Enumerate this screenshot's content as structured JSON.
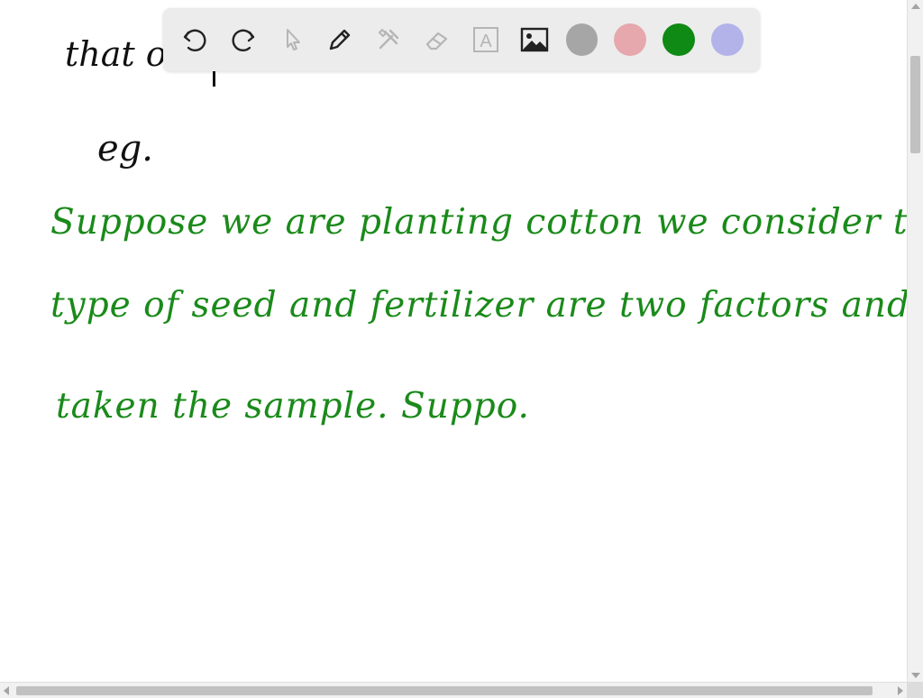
{
  "handwriting": {
    "line_top": "that o",
    "eg": "eg.",
    "line1": "Suppose we are planting cotton we consider the",
    "line2": "type of seed and fertilizer are two factors and",
    "line3": "taken the sample. Suppo."
  },
  "toolbar": {
    "tools": [
      "undo-icon",
      "redo-icon",
      "pointer-icon",
      "pen-icon",
      "tools-icon",
      "eraser-icon",
      "text-icon",
      "image-icon"
    ],
    "text_tool_label": "A",
    "colors": [
      "#a6a6a6",
      "#e6a8ad",
      "#0f8a14",
      "#b3b3ea"
    ]
  }
}
